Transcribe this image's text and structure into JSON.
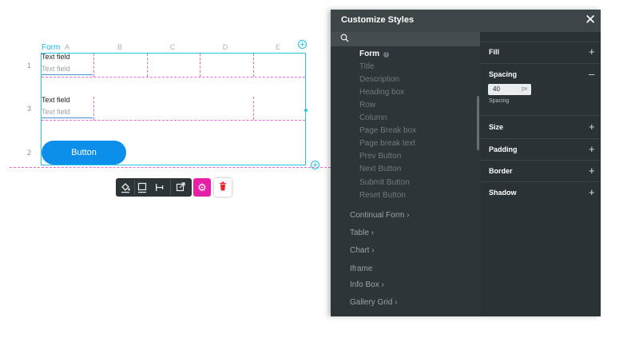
{
  "canvas": {
    "form_tag": "Form",
    "columns": [
      "A",
      "B",
      "C",
      "D",
      "E"
    ],
    "rows": [
      "1",
      "3",
      "2"
    ],
    "fields": [
      {
        "label": "Text field",
        "placeholder": "Text field"
      },
      {
        "label": "Text field",
        "placeholder": "Text field"
      }
    ],
    "button_label": "Button"
  },
  "toolbar": {
    "icons": [
      "fill-icon",
      "border-icon",
      "align-left-icon",
      "external-link-icon",
      "settings-icon",
      "trash-icon"
    ]
  },
  "panel": {
    "title": "Customize Styles",
    "search_placeholder": "",
    "form_items": [
      "Form",
      "Title",
      "Description",
      "Heading box",
      "Row",
      "Column",
      "Page Break box",
      "Page break text",
      "Prev Button",
      "Next Button",
      "Submit Button",
      "Reset Button"
    ],
    "categories": [
      "Continual Form",
      "Table",
      "Chart",
      "Iframe",
      "Info Box",
      "Gallery Grid"
    ],
    "properties": {
      "fill": "Fill",
      "spacing": "Spacing",
      "spacing_value": "40",
      "spacing_unit": "px",
      "spacing_sublabel": "Spacing",
      "size": "Size",
      "padding": "Padding",
      "border": "Border",
      "shadow": "Shadow"
    }
  },
  "colors": {
    "accent": "#0b8fea",
    "gear": "#e61fa7",
    "trash": "#e8262a",
    "selection": "#29c6e0",
    "grid_dash": "#e26bd6",
    "panel_bg": "#2e3538"
  }
}
